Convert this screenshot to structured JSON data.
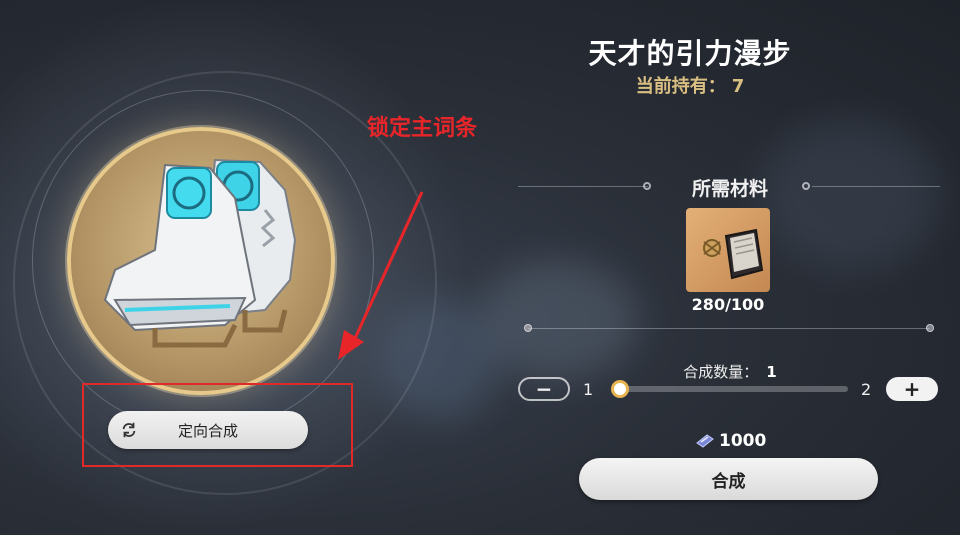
{
  "item": {
    "name": "天才的引力漫步",
    "holding_label": "当前持有：",
    "holding_count": "7",
    "icon": "gravity-skates-icon"
  },
  "directed_craft": {
    "label": "定向合成",
    "icon": "sync-icon"
  },
  "annotation": {
    "text": "锁定主词条",
    "color": "#e8262a"
  },
  "materials": {
    "title": "所需材料",
    "items": [
      {
        "icon": "material-book-icon",
        "count": "280/100"
      }
    ]
  },
  "quantity": {
    "label": "合成数量：",
    "value": "1",
    "min": "1",
    "max": "2",
    "minus_label": "−",
    "plus_label": "+",
    "slider_fraction": 0
  },
  "cost": {
    "icon": "credit-icon",
    "amount": "1000"
  },
  "synthesize": {
    "label": "合成"
  },
  "colors": {
    "accent_gold": "#d9bf82",
    "annotation_red": "#e02a2a",
    "slider_thumb_ring": "#e8b451"
  }
}
